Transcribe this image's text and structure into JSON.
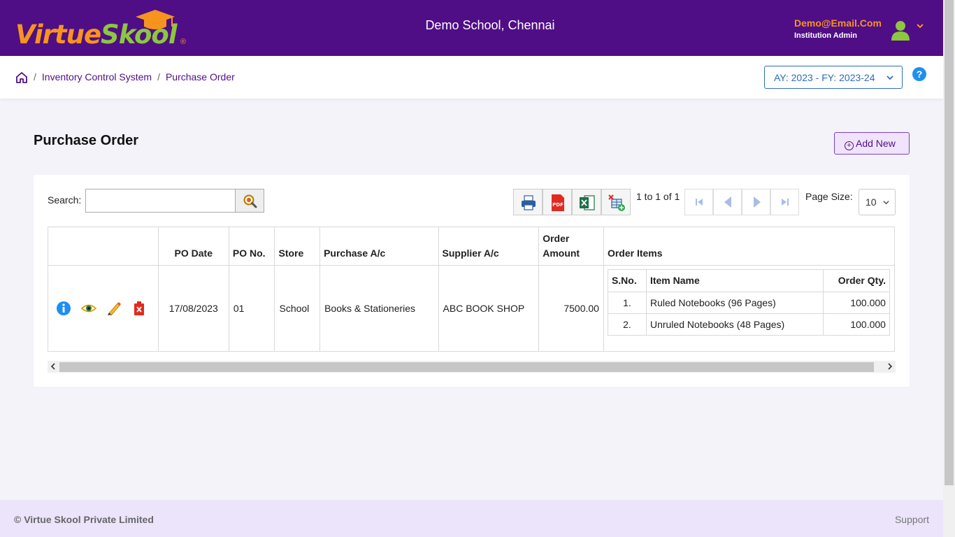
{
  "header": {
    "logo_part1": "Virtue",
    "logo_part2": "Skool",
    "logo_reg": "®",
    "school_name": "Demo School, Chennai",
    "user_email": "Demo@Email.Com",
    "user_role": "Institution Admin"
  },
  "breadcrumb": {
    "items": [
      "Inventory Control System",
      "Purchase Order"
    ],
    "separator": "/"
  },
  "academic_year": "AY: 2023 - FY: 2023-24",
  "help_label": "?",
  "page": {
    "title": "Purchase Order",
    "add_new_label": "Add New"
  },
  "toolbar": {
    "search_label": "Search:",
    "search_value": "",
    "page_info": "1 to 1 of 1",
    "page_size_label": "Page Size:",
    "page_size_value": "10"
  },
  "table": {
    "headers": {
      "po_date": "PO Date",
      "po_no": "PO No.",
      "store": "Store",
      "purchase_ac": "Purchase A/c",
      "supplier_ac": "Supplier A/c",
      "order_amount_line1": "Order",
      "order_amount_line2": "Amount",
      "order_items": "Order Items"
    },
    "rows": [
      {
        "po_date": "17/08/2023",
        "po_no": "01",
        "store": "School",
        "purchase_ac": "Books & Stationeries",
        "supplier_ac": "ABC BOOK SHOP",
        "order_amount": "7500.00",
        "items_headers": {
          "sno": "S.No.",
          "item_name": "Item Name",
          "qty": "Order Qty."
        },
        "items": [
          {
            "sno": "1.",
            "item_name": "Ruled Notebooks (96 Pages)",
            "qty": "100.000"
          },
          {
            "sno": "2.",
            "item_name": "Unruled Notebooks (48 Pages)",
            "qty": "100.000"
          }
        ]
      }
    ]
  },
  "footer": {
    "copyright": "© Virtue Skool Private Limited",
    "support": "Support"
  },
  "colors": {
    "brand_purple": "#4f0e86",
    "brand_orange": "#f7941d",
    "brand_green": "#8dc63f",
    "link_blue": "#2a6ebb"
  }
}
